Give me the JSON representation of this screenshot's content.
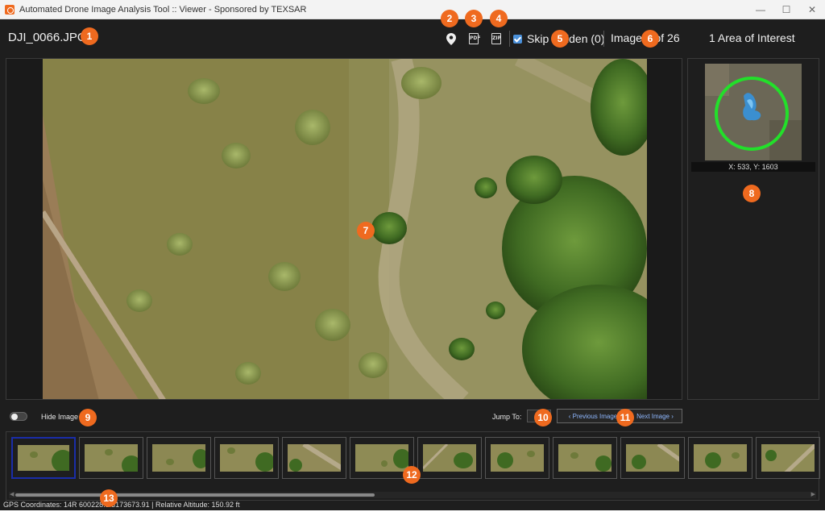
{
  "window": {
    "title": "Automated Drone Image Analysis Tool :: Viewer - Sponsored by TEXSAR",
    "controls": {
      "minimize": "—",
      "maximize": "☐",
      "close": "✕"
    }
  },
  "header": {
    "filename": "DJI_0066.JPG",
    "icons": [
      "map-pin-icon",
      "pdf-icon",
      "zip-icon"
    ],
    "pdf_badge": "PDF",
    "zip_badge": "ZIP",
    "skip_label": "Skip Hidden (0)",
    "skip_checked": true,
    "image_counter": "Image 6 of 26",
    "aoi_count": "1 Area of Interest"
  },
  "aoi": {
    "coords": "X: 533, Y: 1603",
    "circle_color": "#22e02a"
  },
  "controls": {
    "hide_image_label": "Hide Image",
    "jump_to_label": "Jump To:",
    "prev_label": "‹ Previous Image",
    "next_label": "Next Image ›"
  },
  "status": {
    "gps": "GPS Coordinates: 14R 600228.3 3173673.91 | Relative Altitude: 150.92 ft"
  },
  "callouts": [
    "1",
    "2",
    "3",
    "4",
    "5",
    "6",
    "7",
    "8",
    "9",
    "10",
    "11",
    "12",
    "13"
  ],
  "colors": {
    "accent": "#ef6a1f",
    "link": "#8fb8ff",
    "selected_thumb": "#1a2da8",
    "checkbox": "#4a90d9"
  }
}
